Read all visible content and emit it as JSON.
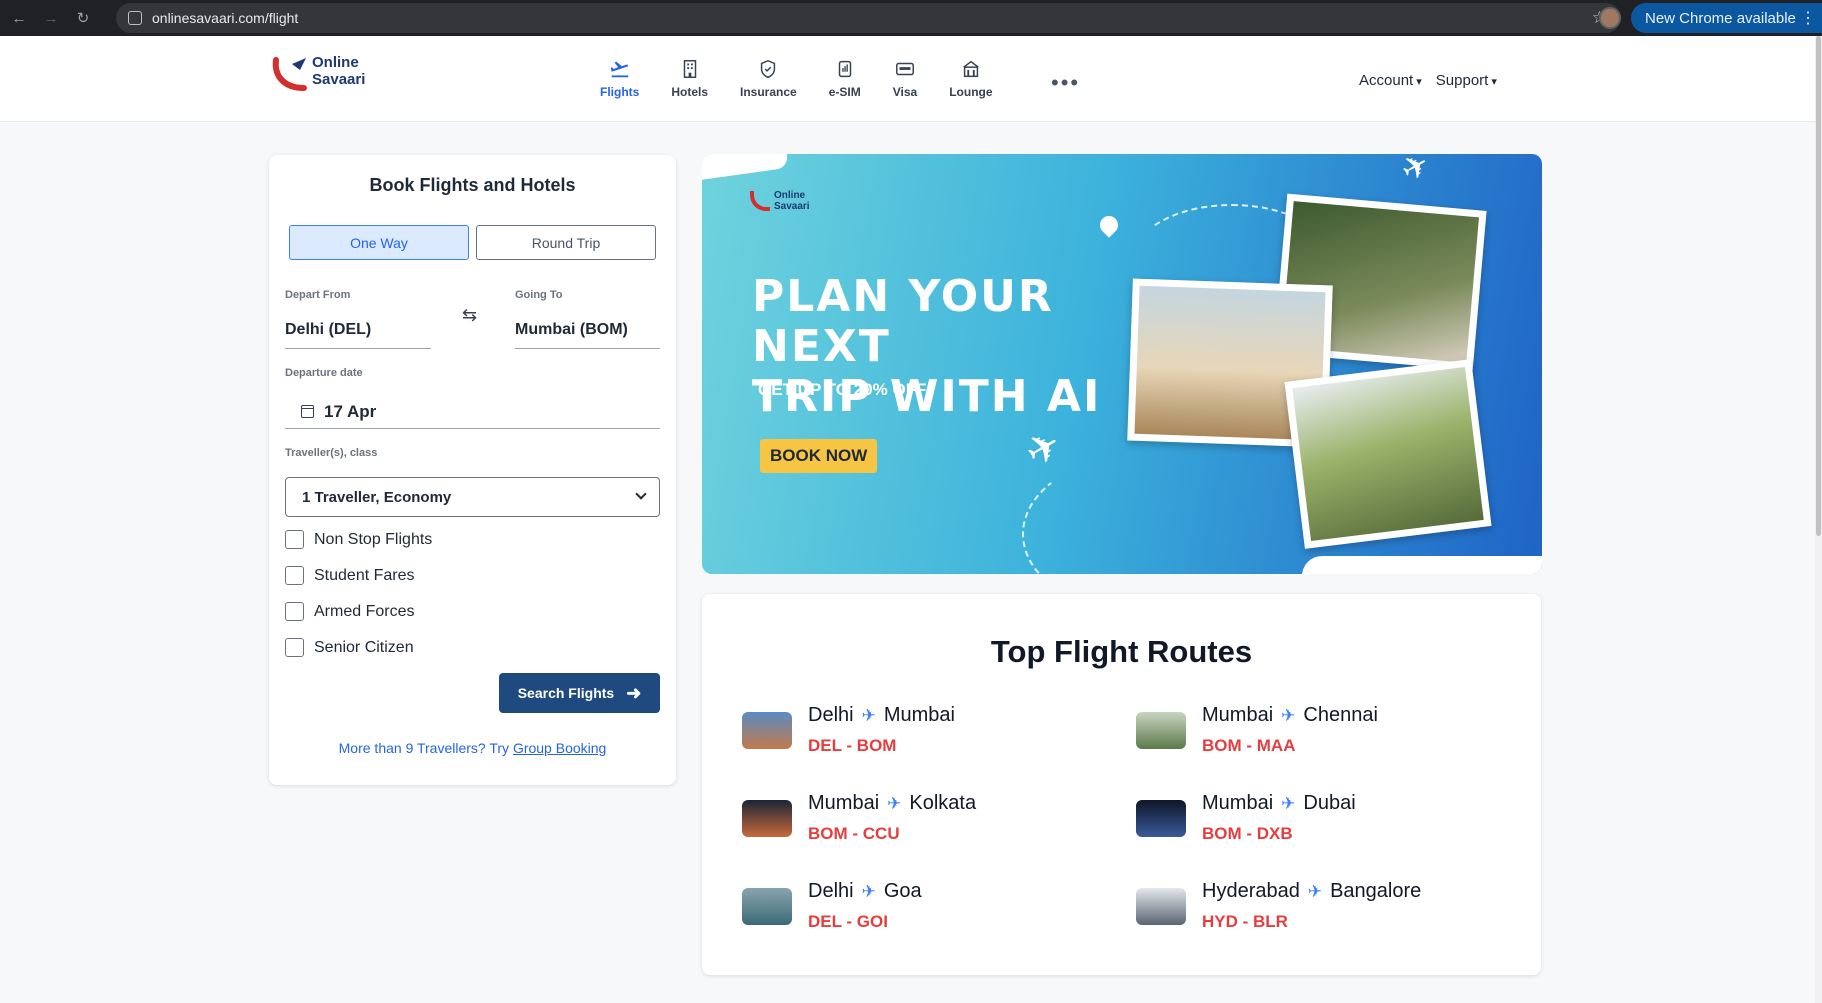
{
  "browser": {
    "url": "onlinesavaari.com/flight",
    "update_label": "New Chrome available"
  },
  "header": {
    "logo_line1": "Online",
    "logo_line2": "Savaari",
    "nav": [
      {
        "label": "Flights",
        "icon": "plane-icon",
        "active": true
      },
      {
        "label": "Hotels",
        "icon": "hotel-icon"
      },
      {
        "label": "Insurance",
        "icon": "shield-icon"
      },
      {
        "label": "e-SIM",
        "icon": "sim-icon"
      },
      {
        "label": "Visa",
        "icon": "visa-card-icon"
      },
      {
        "label": "Lounge",
        "icon": "lounge-icon"
      }
    ],
    "more": "•••",
    "account": "Account",
    "support": "Support"
  },
  "booking": {
    "title": "Book Flights and Hotels",
    "one_way": "One Way",
    "round_trip": "Round Trip",
    "depart_label": "Depart From",
    "depart_value": "Delhi (DEL)",
    "going_label": "Going To",
    "going_value": "Mumbai (BOM)",
    "swap_icon": "⇆",
    "date_label": "Departure date",
    "date_value": "17 Apr",
    "travellers_label": "Traveller(s), class",
    "travellers_value": "1 Traveller, Economy",
    "options": [
      "Non Stop Flights",
      "Student Fares",
      "Armed Forces",
      "Senior Citizen"
    ],
    "search_label": "Search Flights",
    "group_text": "More than 9 Travellers? Try ",
    "group_link": "Group Booking"
  },
  "banner": {
    "logo_line1": "Online",
    "logo_line2": "Savaari",
    "headline_1": "PLAN YOUR NEXT",
    "headline_2": "TRIP WITH AI",
    "subtext": "GET UP TO 20% OFF",
    "cta": "BOOK NOW"
  },
  "routes": {
    "title": "Top Flight Routes",
    "items": [
      {
        "from": "Delhi",
        "to": "Mumbai",
        "code": "DEL - BOM",
        "thumb_color": "#c27a4a"
      },
      {
        "from": "Mumbai",
        "to": "Chennai",
        "code": "BOM - MAA",
        "thumb_color": "#5b7a4a"
      },
      {
        "from": "Mumbai",
        "to": "Kolkata",
        "code": "BOM - CCU",
        "thumb_color": "#2a3a5a"
      },
      {
        "from": "Mumbai",
        "to": "Dubai",
        "code": "BOM - DXB",
        "thumb_color": "#1c2a4a"
      },
      {
        "from": "Delhi",
        "to": "Goa",
        "code": "DEL - GOI",
        "thumb_color": "#4a7a86"
      },
      {
        "from": "Hyderabad",
        "to": "Bangalore",
        "code": "HYD - BLR",
        "thumb_color": "#6a7482"
      }
    ]
  }
}
